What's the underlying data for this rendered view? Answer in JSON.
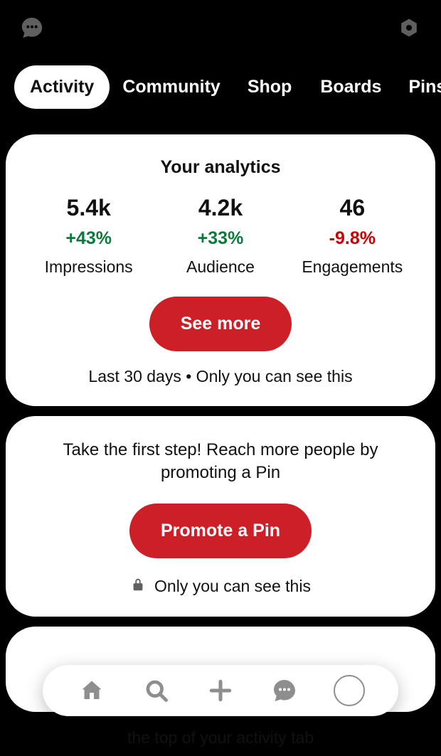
{
  "topbar": {
    "left_icon": "speech-bubble",
    "right_icon": "settings-gear"
  },
  "tabs": {
    "items": [
      {
        "label": "Activity",
        "active": true
      },
      {
        "label": "Community",
        "active": false
      },
      {
        "label": "Shop",
        "active": false
      },
      {
        "label": "Boards",
        "active": false
      },
      {
        "label": "Pins",
        "active": false
      }
    ]
  },
  "analytics": {
    "title": "Your analytics",
    "stats": [
      {
        "value": "5.4k",
        "delta": "+43%",
        "positive": true,
        "label": "Impressions"
      },
      {
        "value": "4.2k",
        "delta": "+33%",
        "positive": true,
        "label": "Audience"
      },
      {
        "value": "46",
        "delta": "-9.8%",
        "positive": false,
        "label": "Engagements"
      }
    ],
    "see_more_label": "See more",
    "footer": "Last 30 days • Only you can see this"
  },
  "promote": {
    "prompt": "Take the first step! Reach more people by promoting a Pin",
    "button_label": "Promote a Pin",
    "privacy_text": "Only you can see this"
  },
  "tail": {
    "text": "the top of your activity tab"
  },
  "colors": {
    "accent": "#cc1f27",
    "positive": "#0a7a3b",
    "negative": "#cc0000"
  }
}
